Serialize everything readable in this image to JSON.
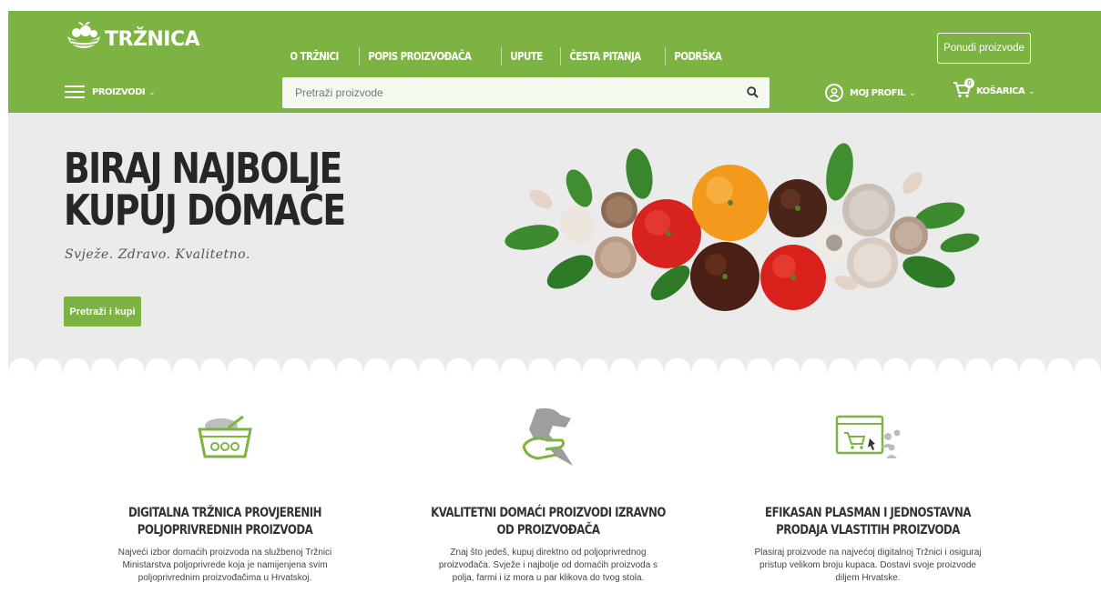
{
  "brand": {
    "name": "TRŽNICA",
    "accent": "#7cb342"
  },
  "topnav": [
    {
      "label": "O TRŽNICI"
    },
    {
      "label": "POPIS PROIZVOĐAČA"
    },
    {
      "label": "UPUTE"
    },
    {
      "label": "ČESTA PITANJA"
    },
    {
      "label": "PODRŠKA"
    }
  ],
  "offer_button": "Ponudi proizvode",
  "products_menu": {
    "label": "PROIZVODI",
    "icon": "hamburger-icon"
  },
  "search": {
    "placeholder": "Pretraži proizvode",
    "icon": "search-icon"
  },
  "profile": {
    "label": "MOJ PROFIL",
    "icon": "user-icon"
  },
  "cart": {
    "label": "KOŠARICA",
    "count": "0",
    "icon": "cart-icon"
  },
  "hero": {
    "title_line1": "BIRAJ NAJBOLJE",
    "title_line2": "KUPUJ DOMAĆE",
    "subtitle": "Svježe. Zdravo. Kvalitetno.",
    "button": "Pretraži i kupi"
  },
  "features": [
    {
      "icon": "basket-icon",
      "title": "DIGITALNA TRŽNICA PROVJERENIH POLJOPRIVREDNIH PROIZVODA",
      "text": "Najveći izbor domaćih proizvoda na službenoj Tržnici Ministarstva poljoprivrede koja je namijenjena svim poljoprivrednim proizvođačima u Hrvatskoj."
    },
    {
      "icon": "croatia-hand-icon",
      "title": "KVALITETNI DOMAĆI PROIZVODI IZRAVNO OD PROIZVOĐAČA",
      "text": "Znaj što jedeš, kupuj direktno od poljoprivrednog proizvođača. Svježe i najbolje od domaćih proizvoda s polja, farmi i iz mora u par klikova do tvog stola."
    },
    {
      "icon": "online-shop-icon",
      "title": "EFIKASAN PLASMAN I JEDNOSTAVNA PRODAJA VLASTITIH PROIZVODA",
      "text": "Plasiraj proizvode na najvećoj digitalnoj Tržnici i osiguraj pristup velikom broju kupaca. Dostavi svoje proizvode diljem Hrvatske."
    }
  ]
}
